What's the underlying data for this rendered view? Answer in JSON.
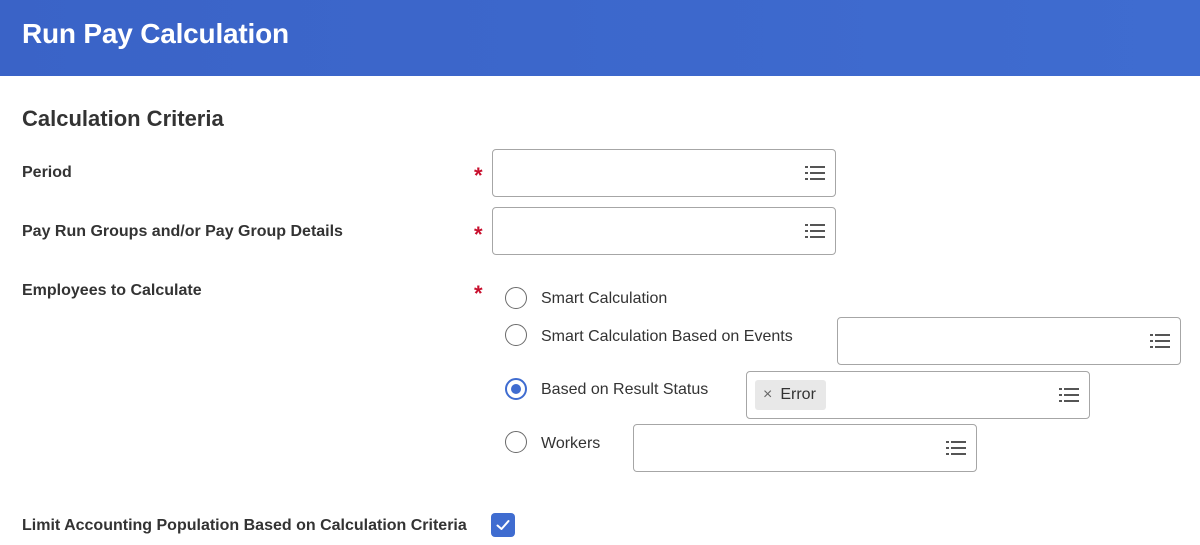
{
  "header": {
    "title": "Run Pay Calculation"
  },
  "section": {
    "title": "Calculation Criteria"
  },
  "fields": {
    "period": {
      "label": "Period",
      "required_mark": "*",
      "value": ""
    },
    "pay_run_groups": {
      "label": "Pay Run Groups and/or Pay Group Details",
      "required_mark": "*",
      "value": ""
    },
    "employees": {
      "label": "Employees to Calculate",
      "required_mark": "*",
      "options": [
        {
          "label": "Smart Calculation",
          "selected": false
        },
        {
          "label": "Smart Calculation Based on Events",
          "selected": false
        },
        {
          "label": "Based on Result Status",
          "selected": true
        },
        {
          "label": "Workers",
          "selected": false
        }
      ],
      "result_status_selection": {
        "remove_glyph": "×",
        "text": "Error"
      }
    },
    "limit_accounting": {
      "label": "Limit Accounting Population Based on Calculation Criteria",
      "checked": true
    }
  },
  "icons": {
    "prompt": "list-icon",
    "remove": "close-icon",
    "check": "checkmark-icon"
  },
  "colors": {
    "header_bg": "#3f6cd0",
    "accent": "#3f6cd0",
    "required": "#c8102e",
    "border": "#a6a6a6"
  }
}
